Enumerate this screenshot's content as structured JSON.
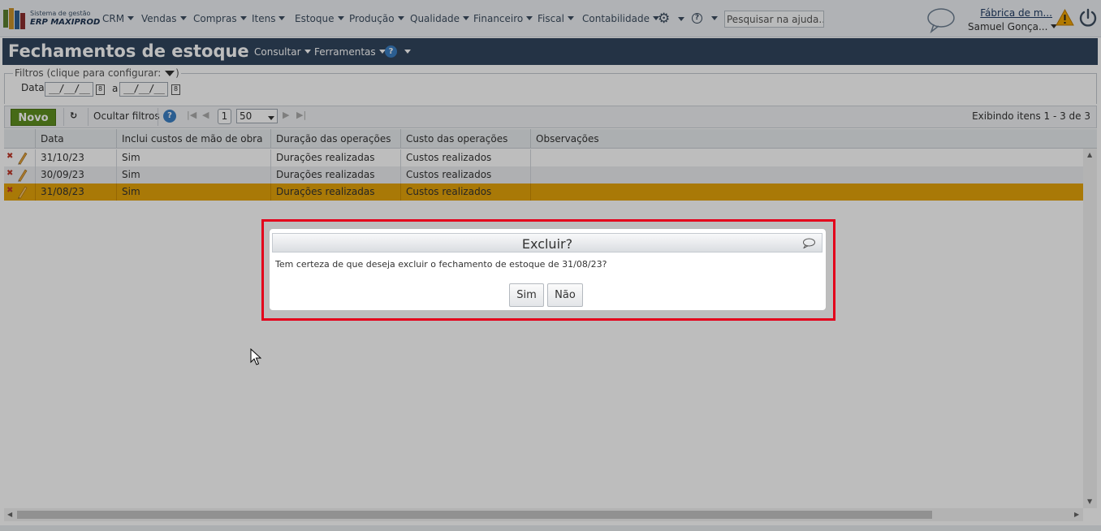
{
  "app": {
    "brand_line1": "Sistema de gestão",
    "brand_line2": "ERP MAXIPROD",
    "company": "Fábrica de m...",
    "user": "Samuel Gonça...",
    "help_search_placeholder": "Pesquisar na ajuda...",
    "icons": [
      "settings-gear-icon",
      "help-icon",
      "chat-bubble-icon",
      "warning-icon",
      "power-icon"
    ]
  },
  "nav": [
    "CRM",
    "Vendas",
    "Compras",
    "Itens",
    "Estoque",
    "Produção",
    "Qualidade",
    "Financeiro",
    "Fiscal",
    "Contabilidade"
  ],
  "window": {
    "title": "Fechamentos de estoque",
    "menus": [
      "Consultar",
      "Ferramentas"
    ]
  },
  "filters": {
    "legend": "Filtros (clique para configurar:",
    "legend_close": ")",
    "date_label": "Data",
    "date_from": "__/__/__",
    "to_label": "a",
    "date_to": "__/__/__"
  },
  "toolbar": {
    "new_label": "Novo",
    "hide_filters": "Ocultar filtros",
    "page": "1",
    "page_size": "50",
    "showing": "Exibindo itens 1 - 3 de 3"
  },
  "grid": {
    "columns": [
      "Data",
      "Inclui custos de mão de obra",
      "Duração das operações",
      "Custo das operações",
      "Observações"
    ],
    "rows": [
      [
        "31/10/23",
        "Sim",
        "Durações realizadas",
        "Custos realizados",
        ""
      ],
      [
        "30/09/23",
        "Sim",
        "Durações realizadas",
        "Custos realizados",
        ""
      ],
      [
        "31/08/23",
        "Sim",
        "Durações realizadas",
        "Custos realizados",
        ""
      ]
    ],
    "selected_row": 2,
    "colors": {
      "selected": "#e5a40a",
      "alt_row": "#eceef1",
      "header": "#31455e",
      "new_button": "#5f8f20",
      "highlight_border": "#e3001b"
    }
  },
  "dialog": {
    "title": "Excluir?",
    "message": "Tem certeza de que deseja excluir o fechamento de estoque de 31/08/23?",
    "yes": "Sim",
    "no": "Não"
  }
}
